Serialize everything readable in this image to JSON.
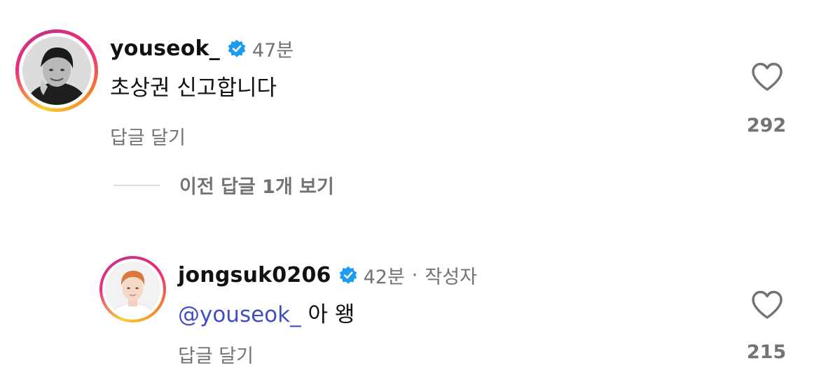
{
  "comments": [
    {
      "username": "youseok_",
      "verified": true,
      "time": "47분",
      "text": "초상권 신고합니다",
      "reply_label": "답글 달기",
      "likes": "292",
      "avatar": "user-avatar-grayscale"
    }
  ],
  "view_replies_label": "이전 답글 1개 보기",
  "reply": {
    "username": "jongsuk0206",
    "verified": true,
    "time": "42분",
    "separator": "·",
    "author_tag": "작성자",
    "mention": "@youseok_",
    "text": " 아 왱",
    "reply_label": "답글 달기",
    "likes": "215",
    "avatar": "user-avatar-color"
  },
  "colors": {
    "verified_blue": "#1d9bf0",
    "mention_blue": "#3f4ec8",
    "secondary_text": "#737373"
  }
}
